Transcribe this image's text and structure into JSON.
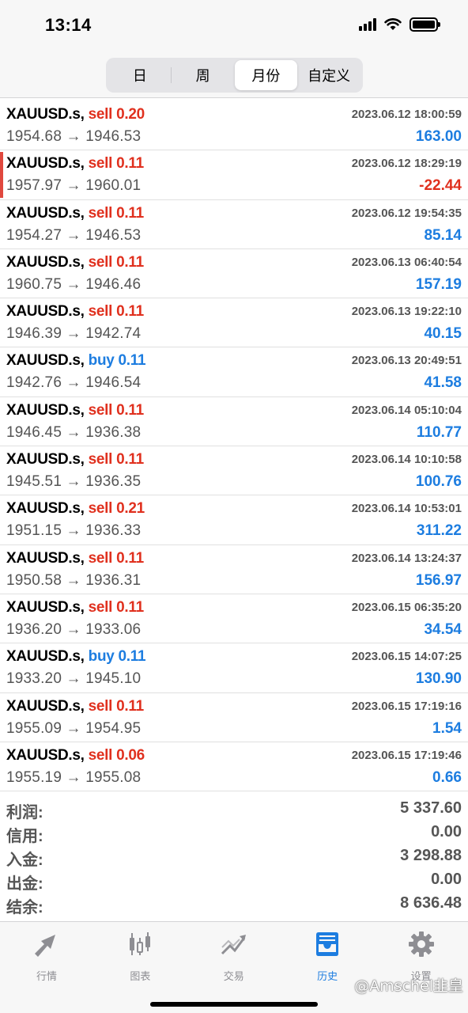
{
  "status": {
    "time": "13:14"
  },
  "tabs_top": [
    "日",
    "周",
    "月份",
    "自定义"
  ],
  "active_top_tab": 2,
  "trades": [
    {
      "symbol": "XAUUSD.s,",
      "side": "sell",
      "lots": "0.20",
      "time": "2023.06.12 18:00:59",
      "prices": "1954.68 → 1946.53",
      "profit": "163.00"
    },
    {
      "symbol": "XAUUSD.s,",
      "side": "sell",
      "lots": "0.11",
      "time": "2023.06.12 18:29:19",
      "prices": "1957.97 → 1960.01",
      "profit": "-22.44"
    },
    {
      "symbol": "XAUUSD.s,",
      "side": "sell",
      "lots": "0.11",
      "time": "2023.06.12 19:54:35",
      "prices": "1954.27 → 1946.53",
      "profit": "85.14"
    },
    {
      "symbol": "XAUUSD.s,",
      "side": "sell",
      "lots": "0.11",
      "time": "2023.06.13 06:40:54",
      "prices": "1960.75 → 1946.46",
      "profit": "157.19"
    },
    {
      "symbol": "XAUUSD.s,",
      "side": "sell",
      "lots": "0.11",
      "time": "2023.06.13 19:22:10",
      "prices": "1946.39 → 1942.74",
      "profit": "40.15"
    },
    {
      "symbol": "XAUUSD.s,",
      "side": "buy",
      "lots": "0.11",
      "time": "2023.06.13 20:49:51",
      "prices": "1942.76 → 1946.54",
      "profit": "41.58"
    },
    {
      "symbol": "XAUUSD.s,",
      "side": "sell",
      "lots": "0.11",
      "time": "2023.06.14 05:10:04",
      "prices": "1946.45 → 1936.38",
      "profit": "110.77"
    },
    {
      "symbol": "XAUUSD.s,",
      "side": "sell",
      "lots": "0.11",
      "time": "2023.06.14 10:10:58",
      "prices": "1945.51 → 1936.35",
      "profit": "100.76"
    },
    {
      "symbol": "XAUUSD.s,",
      "side": "sell",
      "lots": "0.21",
      "time": "2023.06.14 10:53:01",
      "prices": "1951.15 → 1936.33",
      "profit": "311.22"
    },
    {
      "symbol": "XAUUSD.s,",
      "side": "sell",
      "lots": "0.11",
      "time": "2023.06.14 13:24:37",
      "prices": "1950.58 → 1936.31",
      "profit": "156.97"
    },
    {
      "symbol": "XAUUSD.s,",
      "side": "sell",
      "lots": "0.11",
      "time": "2023.06.15 06:35:20",
      "prices": "1936.20 → 1933.06",
      "profit": "34.54"
    },
    {
      "symbol": "XAUUSD.s,",
      "side": "buy",
      "lots": "0.11",
      "time": "2023.06.15 14:07:25",
      "prices": "1933.20 → 1945.10",
      "profit": "130.90"
    },
    {
      "symbol": "XAUUSD.s,",
      "side": "sell",
      "lots": "0.11",
      "time": "2023.06.15 17:19:16",
      "prices": "1955.09 → 1954.95",
      "profit": "1.54"
    },
    {
      "symbol": "XAUUSD.s,",
      "side": "sell",
      "lots": "0.06",
      "time": "2023.06.15 17:19:46",
      "prices": "1955.19 → 1955.08",
      "profit": "0.66"
    }
  ],
  "summary": [
    {
      "label": "利润:",
      "value": "5 337.60"
    },
    {
      "label": "信用:",
      "value": "0.00"
    },
    {
      "label": "入金:",
      "value": "3 298.88"
    },
    {
      "label": "出金:",
      "value": "0.00"
    },
    {
      "label": "结余:",
      "value": "8 636.48"
    }
  ],
  "bottom_tabs": [
    {
      "label": "行情",
      "icon": "quotes-icon"
    },
    {
      "label": "图表",
      "icon": "chart-icon"
    },
    {
      "label": "交易",
      "icon": "trade-icon"
    },
    {
      "label": "历史",
      "icon": "history-icon"
    },
    {
      "label": "设置",
      "icon": "settings-icon"
    }
  ],
  "active_bottom_tab": 3,
  "watermark": "@Amschel韭皇",
  "colors": {
    "sell": "#e0301e",
    "buy": "#1d7de0",
    "accent": "#1d7de0",
    "inactive": "#8e8e93"
  }
}
